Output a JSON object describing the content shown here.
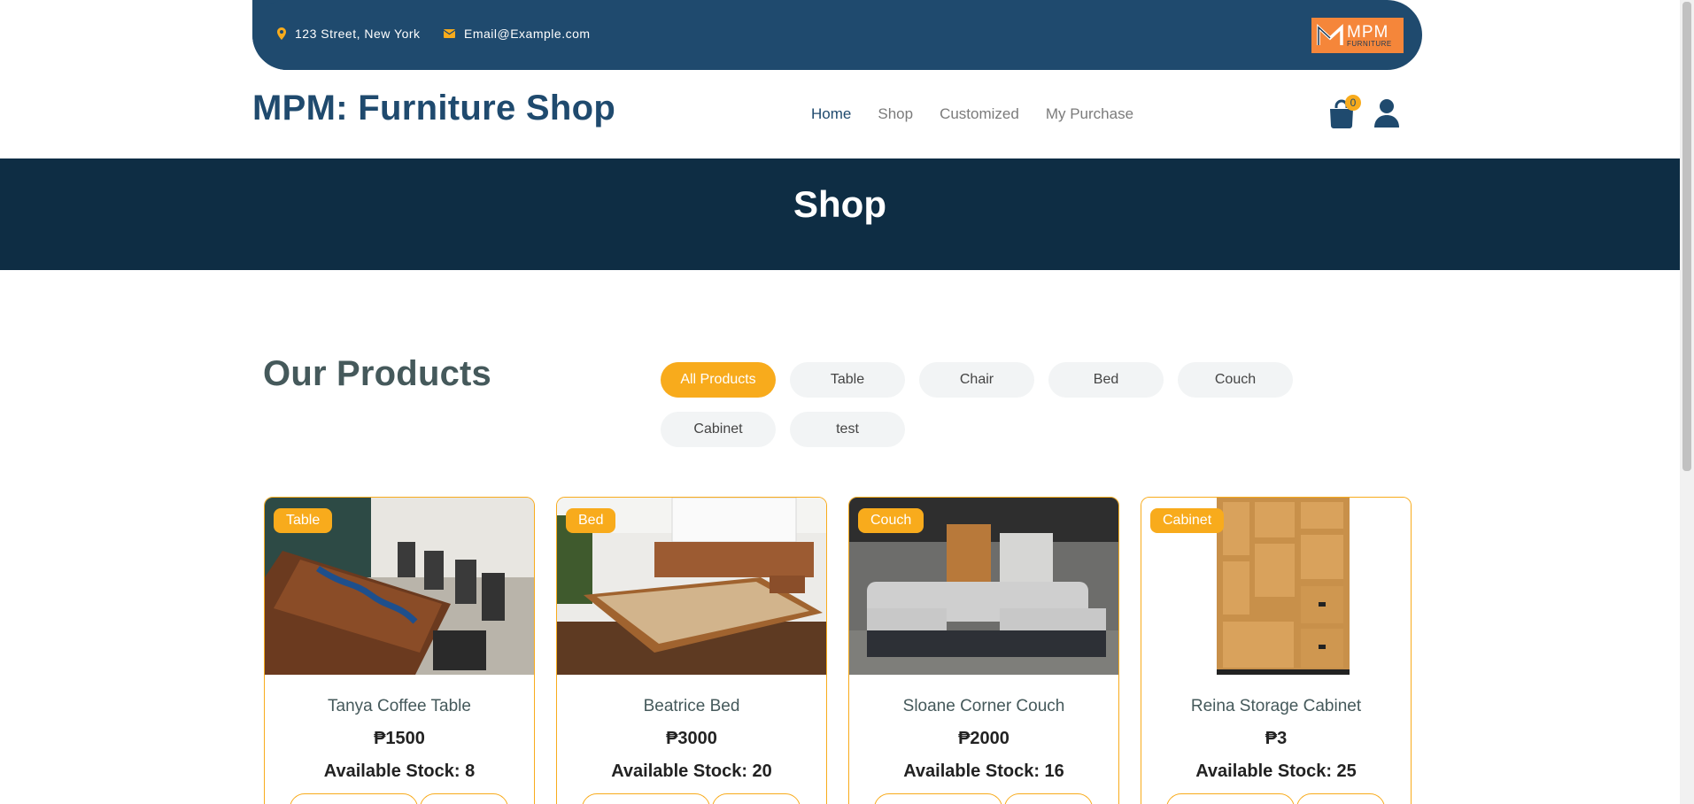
{
  "topbar": {
    "address": "123 Street, New York",
    "email": "Email@Example.com",
    "logo_line1": "MPM",
    "logo_line2": "FURNITURE"
  },
  "header": {
    "brand": "MPM: Furniture Shop",
    "nav": [
      "Home",
      "Shop",
      "Customized",
      "My Purchase"
    ],
    "active_nav": "Home",
    "cart_count": "0"
  },
  "hero": {
    "title": "Shop"
  },
  "products": {
    "title": "Our Products",
    "filters": [
      "All Products",
      "Table",
      "Chair",
      "Bed",
      "Couch",
      "Cabinet",
      "test"
    ],
    "active_filter": "All Products",
    "items": [
      {
        "category": "Table",
        "name": "Tanya Coffee Table",
        "price": "₱1500",
        "stock": "Available Stock: 8"
      },
      {
        "category": "Bed",
        "name": "Beatrice Bed",
        "price": "₱3000",
        "stock": "Available Stock: 20"
      },
      {
        "category": "Couch",
        "name": "Sloane Corner Couch",
        "price": "₱2000",
        "stock": "Available Stock: 16"
      },
      {
        "category": "Cabinet",
        "name": "Reina Storage Cabinet",
        "price": "₱3",
        "stock": "Available Stock: 25"
      }
    ]
  },
  "colors": {
    "primary": "#1f4a6e",
    "accent": "#f8ab1c",
    "hero_bg": "#0e2d44"
  },
  "icons": [
    "map-marker-icon",
    "envelope-icon",
    "shopping-bag-icon",
    "user-icon"
  ]
}
